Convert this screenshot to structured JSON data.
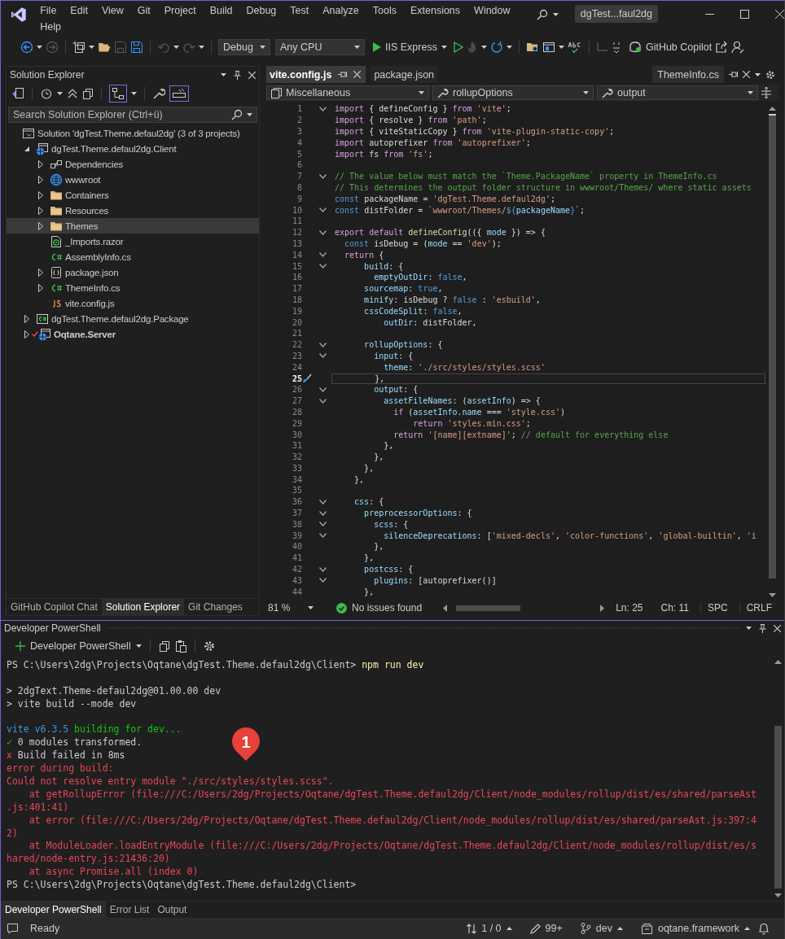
{
  "title_bar": {
    "menu": [
      "File",
      "Edit",
      "View",
      "Git",
      "Project",
      "Build",
      "Debug",
      "Test",
      "Analyze",
      "Tools",
      "Extensions",
      "Window",
      "Help"
    ],
    "solution": "dgTest...faul2dg"
  },
  "toolbar": {
    "configuration": "Debug",
    "platform": "Any CPU",
    "run_target": "IIS Express",
    "copilot": "GitHub Copilot"
  },
  "solution_explorer": {
    "title": "Solution Explorer",
    "search": {
      "placeholder": "Search Solution Explorer (Ctrl+ü)"
    },
    "tree": [
      {
        "label": "Solution 'dgTest.Theme.defaul2dg' (3 of 3 projects)",
        "kind": "solution",
        "expandable": false,
        "selected": false,
        "startup": false,
        "modified": false,
        "children": [
          {
            "label": "dgTest.Theme.defaul2dg.Client",
            "kind": "web-project",
            "expandable": true,
            "expanded": true,
            "selected": false,
            "startup": false,
            "modified": false,
            "children": [
              {
                "label": "Dependencies",
                "kind": "dependencies",
                "expandable": true,
                "expanded": false,
                "selected": false,
                "startup": false,
                "modified": false
              },
              {
                "label": "wwwroot",
                "kind": "globe",
                "expandable": true,
                "expanded": false,
                "selected": false,
                "startup": false,
                "modified": false
              },
              {
                "label": "Containers",
                "kind": "folder",
                "expandable": true,
                "expanded": false,
                "selected": false,
                "startup": false,
                "modified": false
              },
              {
                "label": "Resources",
                "kind": "folder",
                "expandable": true,
                "expanded": false,
                "selected": false,
                "startup": false,
                "modified": false
              },
              {
                "label": "Themes",
                "kind": "folder",
                "expandable": true,
                "expanded": false,
                "selected": true,
                "startup": false,
                "modified": false
              },
              {
                "label": "_Imports.razor",
                "kind": "razor",
                "expandable": false,
                "selected": false,
                "startup": false,
                "modified": false
              },
              {
                "label": "AssemblyInfo.cs",
                "kind": "csharp",
                "expandable": false,
                "selected": false,
                "startup": false,
                "modified": false
              },
              {
                "label": "package.json",
                "kind": "json",
                "expandable": true,
                "expanded": false,
                "selected": false,
                "startup": false,
                "modified": false
              },
              {
                "label": "ThemeInfo.cs",
                "kind": "csharp",
                "expandable": true,
                "expanded": false,
                "selected": false,
                "startup": false,
                "modified": false
              },
              {
                "label": "vite.config.js",
                "kind": "js",
                "expandable": false,
                "selected": false,
                "startup": false,
                "modified": false
              }
            ]
          },
          {
            "label": "dgTest.Theme.defaul2dg.Package",
            "kind": "csharp-project",
            "expandable": true,
            "expanded": false,
            "selected": false,
            "startup": false,
            "modified": false
          },
          {
            "label": "Oqtane.Server",
            "kind": "web-project",
            "expandable": true,
            "expanded": false,
            "selected": false,
            "startup": true,
            "modified": true
          }
        ]
      }
    ],
    "tabs": [
      {
        "label": "GitHub Copilot Chat",
        "selected": false
      },
      {
        "label": "Solution Explorer",
        "selected": true
      },
      {
        "label": "Git Changes",
        "selected": false
      }
    ]
  },
  "editor": {
    "tabs": [
      {
        "label": "vite.config.js",
        "selected": true
      },
      {
        "label": "package.json",
        "selected": false
      }
    ],
    "side_tab": "ThemeInfo.cs",
    "nav": [
      "Miscellaneous",
      "rollupOptions",
      "output"
    ],
    "lines": [
      {
        "number": "1",
        "fold": true,
        "current": false,
        "tokens": [
          {
            "kind": "keyword",
            "text": "import"
          },
          {
            "kind": "plain",
            "text": " { defineConfig } "
          },
          {
            "kind": "keyword",
            "text": "from"
          },
          {
            "kind": "string",
            "text": " 'vite'"
          },
          {
            "kind": "plain",
            "text": ";"
          }
        ]
      },
      {
        "number": "2",
        "fold": false,
        "current": false,
        "tokens": [
          {
            "kind": "keyword",
            "text": "import"
          },
          {
            "kind": "plain",
            "text": " { resolve } "
          },
          {
            "kind": "keyword",
            "text": "from"
          },
          {
            "kind": "string",
            "text": " 'path'"
          },
          {
            "kind": "plain",
            "text": ";"
          }
        ]
      },
      {
        "number": "3",
        "fold": false,
        "current": false,
        "tokens": [
          {
            "kind": "keyword",
            "text": "import"
          },
          {
            "kind": "plain",
            "text": " { viteStaticCopy } "
          },
          {
            "kind": "keyword",
            "text": "from"
          },
          {
            "kind": "string",
            "text": " 'vite-plugin-static-copy'"
          },
          {
            "kind": "plain",
            "text": ";"
          }
        ]
      },
      {
        "number": "4",
        "fold": false,
        "current": false,
        "tokens": [
          {
            "kind": "keyword",
            "text": "import"
          },
          {
            "kind": "plain",
            "text": " autoprefixer "
          },
          {
            "kind": "keyword",
            "text": "from"
          },
          {
            "kind": "string",
            "text": " 'autoprefixer'"
          },
          {
            "kind": "plain",
            "text": ";"
          }
        ]
      },
      {
        "number": "5",
        "fold": false,
        "current": false,
        "tokens": [
          {
            "kind": "keyword",
            "text": "import"
          },
          {
            "kind": "plain",
            "text": " fs "
          },
          {
            "kind": "keyword",
            "text": "from"
          },
          {
            "kind": "string",
            "text": " 'fs'"
          },
          {
            "kind": "plain",
            "text": ";"
          }
        ]
      },
      {
        "number": "6",
        "fold": false,
        "current": false
      },
      {
        "number": "7",
        "fold": true,
        "current": false,
        "tokens": [
          {
            "kind": "comment",
            "text": "// The value below must match the `Theme.PackageName` property in ThemeInfo.cs"
          }
        ]
      },
      {
        "number": "8",
        "fold": false,
        "current": false,
        "tokens": [
          {
            "kind": "comment",
            "text": "// This determines the output folder structure in wwwroot/Themes/ where static assets"
          }
        ]
      },
      {
        "number": "9",
        "fold": false,
        "current": false,
        "tokens": [
          {
            "kind": "storage",
            "text": "const"
          },
          {
            "kind": "plain",
            "text": " packageName = "
          },
          {
            "kind": "string",
            "text": "'dgTest.Theme.defaul2dg'"
          },
          {
            "kind": "plain",
            "text": ";"
          }
        ]
      },
      {
        "number": "10",
        "fold": true,
        "current": false,
        "tokens": [
          {
            "kind": "storage",
            "text": "const"
          },
          {
            "kind": "plain",
            "text": " distFolder = "
          },
          {
            "kind": "string",
            "text": "`wwwroot/Themes/"
          },
          {
            "kind": "storage",
            "text": "${"
          },
          {
            "kind": "identifier",
            "text": "packageName"
          },
          {
            "kind": "storage",
            "text": "}"
          },
          {
            "kind": "string",
            "text": "`"
          },
          {
            "kind": "plain",
            "text": ";"
          }
        ]
      },
      {
        "number": "11",
        "fold": false,
        "current": false
      },
      {
        "number": "12",
        "fold": true,
        "current": false,
        "tokens": [
          {
            "kind": "keyword",
            "text": "export default"
          },
          {
            "kind": "function",
            "text": " defineConfig"
          },
          {
            "kind": "plain",
            "text": "(({ "
          },
          {
            "kind": "identifier",
            "text": "mode"
          },
          {
            "kind": "plain",
            "text": " }) => {"
          }
        ]
      },
      {
        "number": "13",
        "fold": false,
        "current": false,
        "tokens": [
          {
            "kind": "storage",
            "text": "  const"
          },
          {
            "kind": "plain",
            "text": " isDebug = ("
          },
          {
            "kind": "identifier",
            "text": "mode"
          },
          {
            "kind": "plain",
            "text": " == "
          },
          {
            "kind": "string",
            "text": "'dev'"
          },
          {
            "kind": "plain",
            "text": ");"
          }
        ]
      },
      {
        "number": "14",
        "fold": true,
        "current": false,
        "tokens": [
          {
            "kind": "keyword",
            "text": "  return"
          },
          {
            "kind": "plain",
            "text": " {"
          }
        ]
      },
      {
        "number": "15",
        "fold": true,
        "current": false,
        "tokens": [
          {
            "kind": "identifier",
            "text": "      build"
          },
          {
            "kind": "plain",
            "text": ": {"
          }
        ]
      },
      {
        "number": "16",
        "fold": false,
        "current": false,
        "tokens": [
          {
            "kind": "identifier",
            "text": "        emptyOutDir"
          },
          {
            "kind": "plain",
            "text": ": "
          },
          {
            "kind": "storage",
            "text": "false"
          },
          {
            "kind": "plain",
            "text": ","
          }
        ]
      },
      {
        "number": "17",
        "fold": false,
        "current": false,
        "tokens": [
          {
            "kind": "identifier",
            "text": "      sourcemap"
          },
          {
            "kind": "plain",
            "text": ": "
          },
          {
            "kind": "storage",
            "text": "true"
          },
          {
            "kind": "plain",
            "text": ","
          }
        ]
      },
      {
        "number": "18",
        "fold": false,
        "current": false,
        "tokens": [
          {
            "kind": "identifier",
            "text": "      minify"
          },
          {
            "kind": "plain",
            "text": ": isDebug ? "
          },
          {
            "kind": "storage",
            "text": "false"
          },
          {
            "kind": "plain",
            "text": " : "
          },
          {
            "kind": "string",
            "text": "'esbuild'"
          },
          {
            "kind": "plain",
            "text": ","
          }
        ]
      },
      {
        "number": "19",
        "fold": false,
        "current": false,
        "tokens": [
          {
            "kind": "identifier",
            "text": "      cssCodeSplit"
          },
          {
            "kind": "plain",
            "text": ": "
          },
          {
            "kind": "storage",
            "text": "false"
          },
          {
            "kind": "plain",
            "text": ","
          }
        ]
      },
      {
        "number": "20",
        "fold": false,
        "current": false,
        "tokens": [
          {
            "kind": "identifier",
            "text": "          outDir"
          },
          {
            "kind": "plain",
            "text": ": distFolder,"
          }
        ]
      },
      {
        "number": "21",
        "fold": false,
        "current": false
      },
      {
        "number": "22",
        "fold": true,
        "current": false,
        "tokens": [
          {
            "kind": "identifier",
            "text": "      rollupOptions"
          },
          {
            "kind": "plain",
            "text": ": {"
          }
        ]
      },
      {
        "number": "23",
        "fold": true,
        "current": false,
        "tokens": [
          {
            "kind": "identifier",
            "text": "        input"
          },
          {
            "kind": "plain",
            "text": ": {"
          }
        ]
      },
      {
        "number": "24",
        "fold": false,
        "current": false,
        "tokens": [
          {
            "kind": "identifier",
            "text": "          theme"
          },
          {
            "kind": "plain",
            "text": ": "
          },
          {
            "kind": "string",
            "text": "'./src/styles/styles.scss'"
          }
        ]
      },
      {
        "number": "25",
        "fold": false,
        "current": true,
        "tokens": [
          {
            "kind": "plain",
            "text": "        },"
          }
        ]
      },
      {
        "number": "26",
        "fold": true,
        "current": false,
        "tokens": [
          {
            "kind": "identifier",
            "text": "        output"
          },
          {
            "kind": "plain",
            "text": ": {"
          }
        ]
      },
      {
        "number": "27",
        "fold": true,
        "current": false,
        "tokens": [
          {
            "kind": "identifier",
            "text": "          assetFileNames"
          },
          {
            "kind": "plain",
            "text": ": ("
          },
          {
            "kind": "identifier",
            "text": "assetInfo"
          },
          {
            "kind": "plain",
            "text": ") => {"
          }
        ]
      },
      {
        "number": "28",
        "fold": false,
        "current": false,
        "tokens": [
          {
            "kind": "keyword",
            "text": "            if"
          },
          {
            "kind": "plain",
            "text": " ("
          },
          {
            "kind": "identifier",
            "text": "assetInfo.name"
          },
          {
            "kind": "plain",
            "text": " === "
          },
          {
            "kind": "string",
            "text": "'style.css'"
          },
          {
            "kind": "plain",
            "text": ")"
          }
        ]
      },
      {
        "number": "29",
        "fold": false,
        "current": false,
        "tokens": [
          {
            "kind": "keyword",
            "text": "                return"
          },
          {
            "kind": "string",
            "text": " 'styles.min.css'"
          },
          {
            "kind": "plain",
            "text": ";"
          }
        ]
      },
      {
        "number": "30",
        "fold": false,
        "current": false,
        "tokens": [
          {
            "kind": "keyword",
            "text": "            return"
          },
          {
            "kind": "string",
            "text": " '[name][extname]'"
          },
          {
            "kind": "plain",
            "text": "; "
          },
          {
            "kind": "comment",
            "text": "// default for everything else"
          }
        ]
      },
      {
        "number": "31",
        "fold": false,
        "current": false,
        "tokens": [
          {
            "kind": "plain",
            "text": "          },"
          }
        ]
      },
      {
        "number": "32",
        "fold": false,
        "current": false,
        "tokens": [
          {
            "kind": "plain",
            "text": "        },"
          }
        ]
      },
      {
        "number": "33",
        "fold": false,
        "current": false,
        "tokens": [
          {
            "kind": "plain",
            "text": "      },"
          }
        ]
      },
      {
        "number": "34",
        "fold": false,
        "current": false,
        "tokens": [
          {
            "kind": "plain",
            "text": "    },"
          }
        ]
      },
      {
        "number": "35",
        "fold": false,
        "current": false
      },
      {
        "number": "36",
        "fold": true,
        "current": false,
        "tokens": [
          {
            "kind": "identifier",
            "text": "    css"
          },
          {
            "kind": "plain",
            "text": ": {"
          }
        ]
      },
      {
        "number": "37",
        "fold": true,
        "current": false,
        "tokens": [
          {
            "kind": "identifier",
            "text": "      preprocessorOptions"
          },
          {
            "kind": "plain",
            "text": ": {"
          }
        ]
      },
      {
        "number": "38",
        "fold": true,
        "current": false,
        "tokens": [
          {
            "kind": "identifier",
            "text": "        scss"
          },
          {
            "kind": "plain",
            "text": ": {"
          }
        ]
      },
      {
        "number": "39",
        "fold": true,
        "current": false,
        "tokens": [
          {
            "kind": "identifier",
            "text": "          silenceDeprecations"
          },
          {
            "kind": "plain",
            "text": ": ["
          },
          {
            "kind": "string",
            "text": "'mixed-decls'"
          },
          {
            "kind": "plain",
            "text": ", "
          },
          {
            "kind": "string",
            "text": "'color-functions'"
          },
          {
            "kind": "plain",
            "text": ", "
          },
          {
            "kind": "string",
            "text": "'global-builtin'"
          },
          {
            "kind": "plain",
            "text": ", "
          },
          {
            "kind": "string",
            "text": "'i"
          }
        ]
      },
      {
        "number": "40",
        "fold": false,
        "current": false,
        "tokens": [
          {
            "kind": "plain",
            "text": "        },"
          }
        ]
      },
      {
        "number": "41",
        "fold": false,
        "current": false,
        "tokens": [
          {
            "kind": "plain",
            "text": "      },"
          }
        ]
      },
      {
        "number": "42",
        "fold": true,
        "current": false,
        "tokens": [
          {
            "kind": "identifier",
            "text": "      postcss"
          },
          {
            "kind": "plain",
            "text": ": {"
          }
        ]
      },
      {
        "number": "43",
        "fold": true,
        "current": false,
        "tokens": [
          {
            "kind": "identifier",
            "text": "        plugins"
          },
          {
            "kind": "plain",
            "text": ": [autoprefixer()]"
          }
        ]
      },
      {
        "number": "44",
        "fold": false,
        "current": false,
        "tokens": [
          {
            "kind": "plain",
            "text": "      },"
          }
        ]
      }
    ],
    "zoom": "81 %",
    "health": "No issues found",
    "line": "Ln: 25",
    "column": "Ch: 11",
    "indent": "SPC",
    "line_endings": "CRLF"
  },
  "terminal": {
    "title": "Developer PowerShell",
    "shell": "Developer PowerShell",
    "lines": [
      {
        "kind": "text",
        "segments": [
          {
            "kind": "plain",
            "text": "PS C:\\Users\\2dg\\Projects\\Oqtane\\dgTest.Theme.defaul2dg\\Client> "
          },
          {
            "kind": "command",
            "text": "npm run dev"
          }
        ]
      },
      {
        "kind": "blank"
      },
      {
        "kind": "text",
        "segments": [
          {
            "kind": "plain",
            "text": "> 2dgText.Theme-defaul2dg@01.00.00 dev"
          }
        ]
      },
      {
        "kind": "text",
        "segments": [
          {
            "kind": "plain",
            "text": "> vite build --mode dev"
          }
        ]
      },
      {
        "kind": "blank"
      },
      {
        "kind": "text",
        "segments": [
          {
            "kind": "version",
            "text": "vite v6.3.5"
          },
          {
            "kind": "success",
            "text": " building for dev..."
          }
        ]
      },
      {
        "kind": "text",
        "segments": [
          {
            "kind": "success",
            "text": "✓"
          },
          {
            "kind": "plain",
            "text": " 0 modules transformed."
          }
        ]
      },
      {
        "kind": "text",
        "segments": [
          {
            "kind": "error",
            "text": "x"
          },
          {
            "kind": "plain",
            "text": " Build failed in 8ms"
          }
        ]
      },
      {
        "kind": "text",
        "segments": [
          {
            "kind": "error",
            "text": "error during build:"
          }
        ]
      },
      {
        "kind": "text",
        "segments": [
          {
            "kind": "error",
            "text": "Could not resolve entry module \"./src/styles/styles.scss\"."
          }
        ]
      },
      {
        "kind": "text",
        "segments": [
          {
            "kind": "error",
            "text": "    at getRollupError (file:///C:/Users/2dg/Projects/Oqtane/dgTest.Theme.defaul2dg/Client/node_modules/rollup/dist/es/shared/parseAst"
          }
        ]
      },
      {
        "kind": "text",
        "segments": [
          {
            "kind": "error",
            "text": ".js:401:41)"
          }
        ]
      },
      {
        "kind": "text",
        "segments": [
          {
            "kind": "error",
            "text": "    at error (file:///C:/Users/2dg/Projects/Oqtane/dgTest.Theme.defaul2dg/Client/node_modules/rollup/dist/es/shared/parseAst.js:397:4"
          }
        ]
      },
      {
        "kind": "text",
        "segments": [
          {
            "kind": "error",
            "text": "2)"
          }
        ]
      },
      {
        "kind": "text",
        "segments": [
          {
            "kind": "error",
            "text": "    at ModuleLoader.loadEntryModule (file:///C:/Users/2dg/Projects/Oqtane/dgTest.Theme.defaul2dg/Client/node_modules/rollup/dist/es/s"
          }
        ]
      },
      {
        "kind": "text",
        "segments": [
          {
            "kind": "error",
            "text": "hared/node-entry.js:21436:20)"
          }
        ]
      },
      {
        "kind": "text",
        "segments": [
          {
            "kind": "error",
            "text": "    at async Promise.all (index 0)"
          }
        ]
      },
      {
        "kind": "text",
        "segments": [
          {
            "kind": "plain",
            "text": "PS C:\\Users\\2dg\\Projects\\Oqtane\\dgTest.Theme.defaul2dg\\Client>"
          }
        ]
      }
    ],
    "callout": "1",
    "tabs": [
      {
        "label": "Developer PowerShell",
        "selected": true
      },
      {
        "label": "Error List",
        "selected": false
      },
      {
        "label": "Output",
        "selected": false
      }
    ]
  },
  "status_bar": {
    "state": "Ready",
    "changes": "1 / 0",
    "edits": "99+",
    "branch": "dev",
    "repository": "oqtane.framework"
  }
}
